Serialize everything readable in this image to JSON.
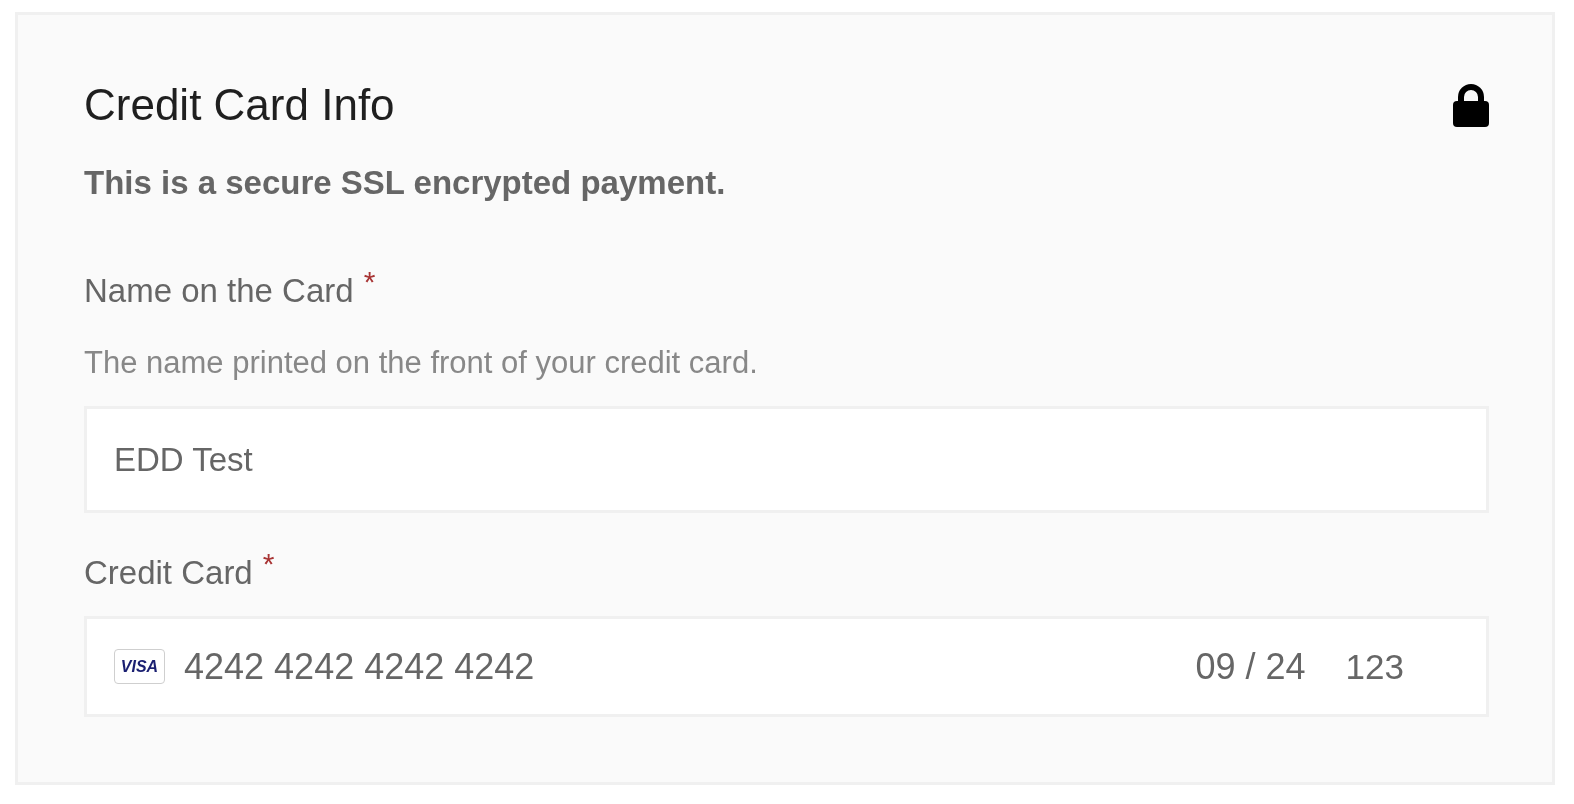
{
  "section": {
    "title": "Credit Card Info",
    "secure_note": "This is a secure SSL encrypted payment."
  },
  "fields": [
    {
      "kind": "text",
      "label": "Name on the Card",
      "required_mark": "*",
      "description": "The name printed on the front of your credit card.",
      "value": "EDD Test"
    },
    {
      "kind": "card",
      "label": "Credit Card",
      "required_mark": "*",
      "brand": "VISA",
      "number": "4242 4242 4242 4242",
      "expiry": "09 / 24",
      "cvc": "123"
    }
  ]
}
